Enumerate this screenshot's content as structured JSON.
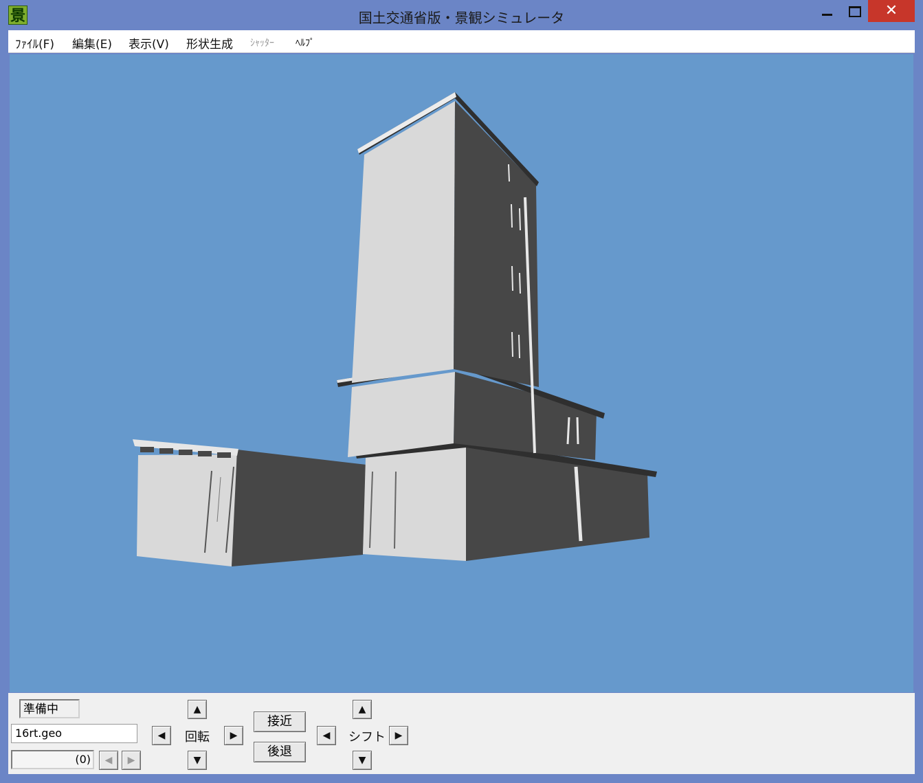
{
  "window": {
    "icon_glyph": "景",
    "title": "国土交通省版・景観シミュレータ",
    "close_glyph": "✕"
  },
  "menu": {
    "items": [
      {
        "label": "ﾌｧｲﾙ(F)",
        "enabled": true
      },
      {
        "label": "編集(E)",
        "enabled": true
      },
      {
        "label": "表示(V)",
        "enabled": true
      },
      {
        "label": "形状生成",
        "enabled": true
      },
      {
        "label": "ｼｬｯﾀｰ",
        "enabled": false
      },
      {
        "label": "ﾍﾙﾌﾟ",
        "enabled": true
      }
    ]
  },
  "colors": {
    "sky": "#6699cc",
    "building_light": "#d9d9d9",
    "building_dark": "#474747",
    "title_bar": "#6b85c6",
    "close_button": "#c7362a"
  },
  "controls": {
    "status": "準備中",
    "file_name": "16rt.geo",
    "frame_count": "(0)",
    "rotate_label": "回転",
    "shift_label": "シフト",
    "approach_label": "接近",
    "retreat_label": "後退",
    "arrow_up": "▲",
    "arrow_down": "▼",
    "arrow_left": "◀",
    "arrow_right": "▶"
  }
}
